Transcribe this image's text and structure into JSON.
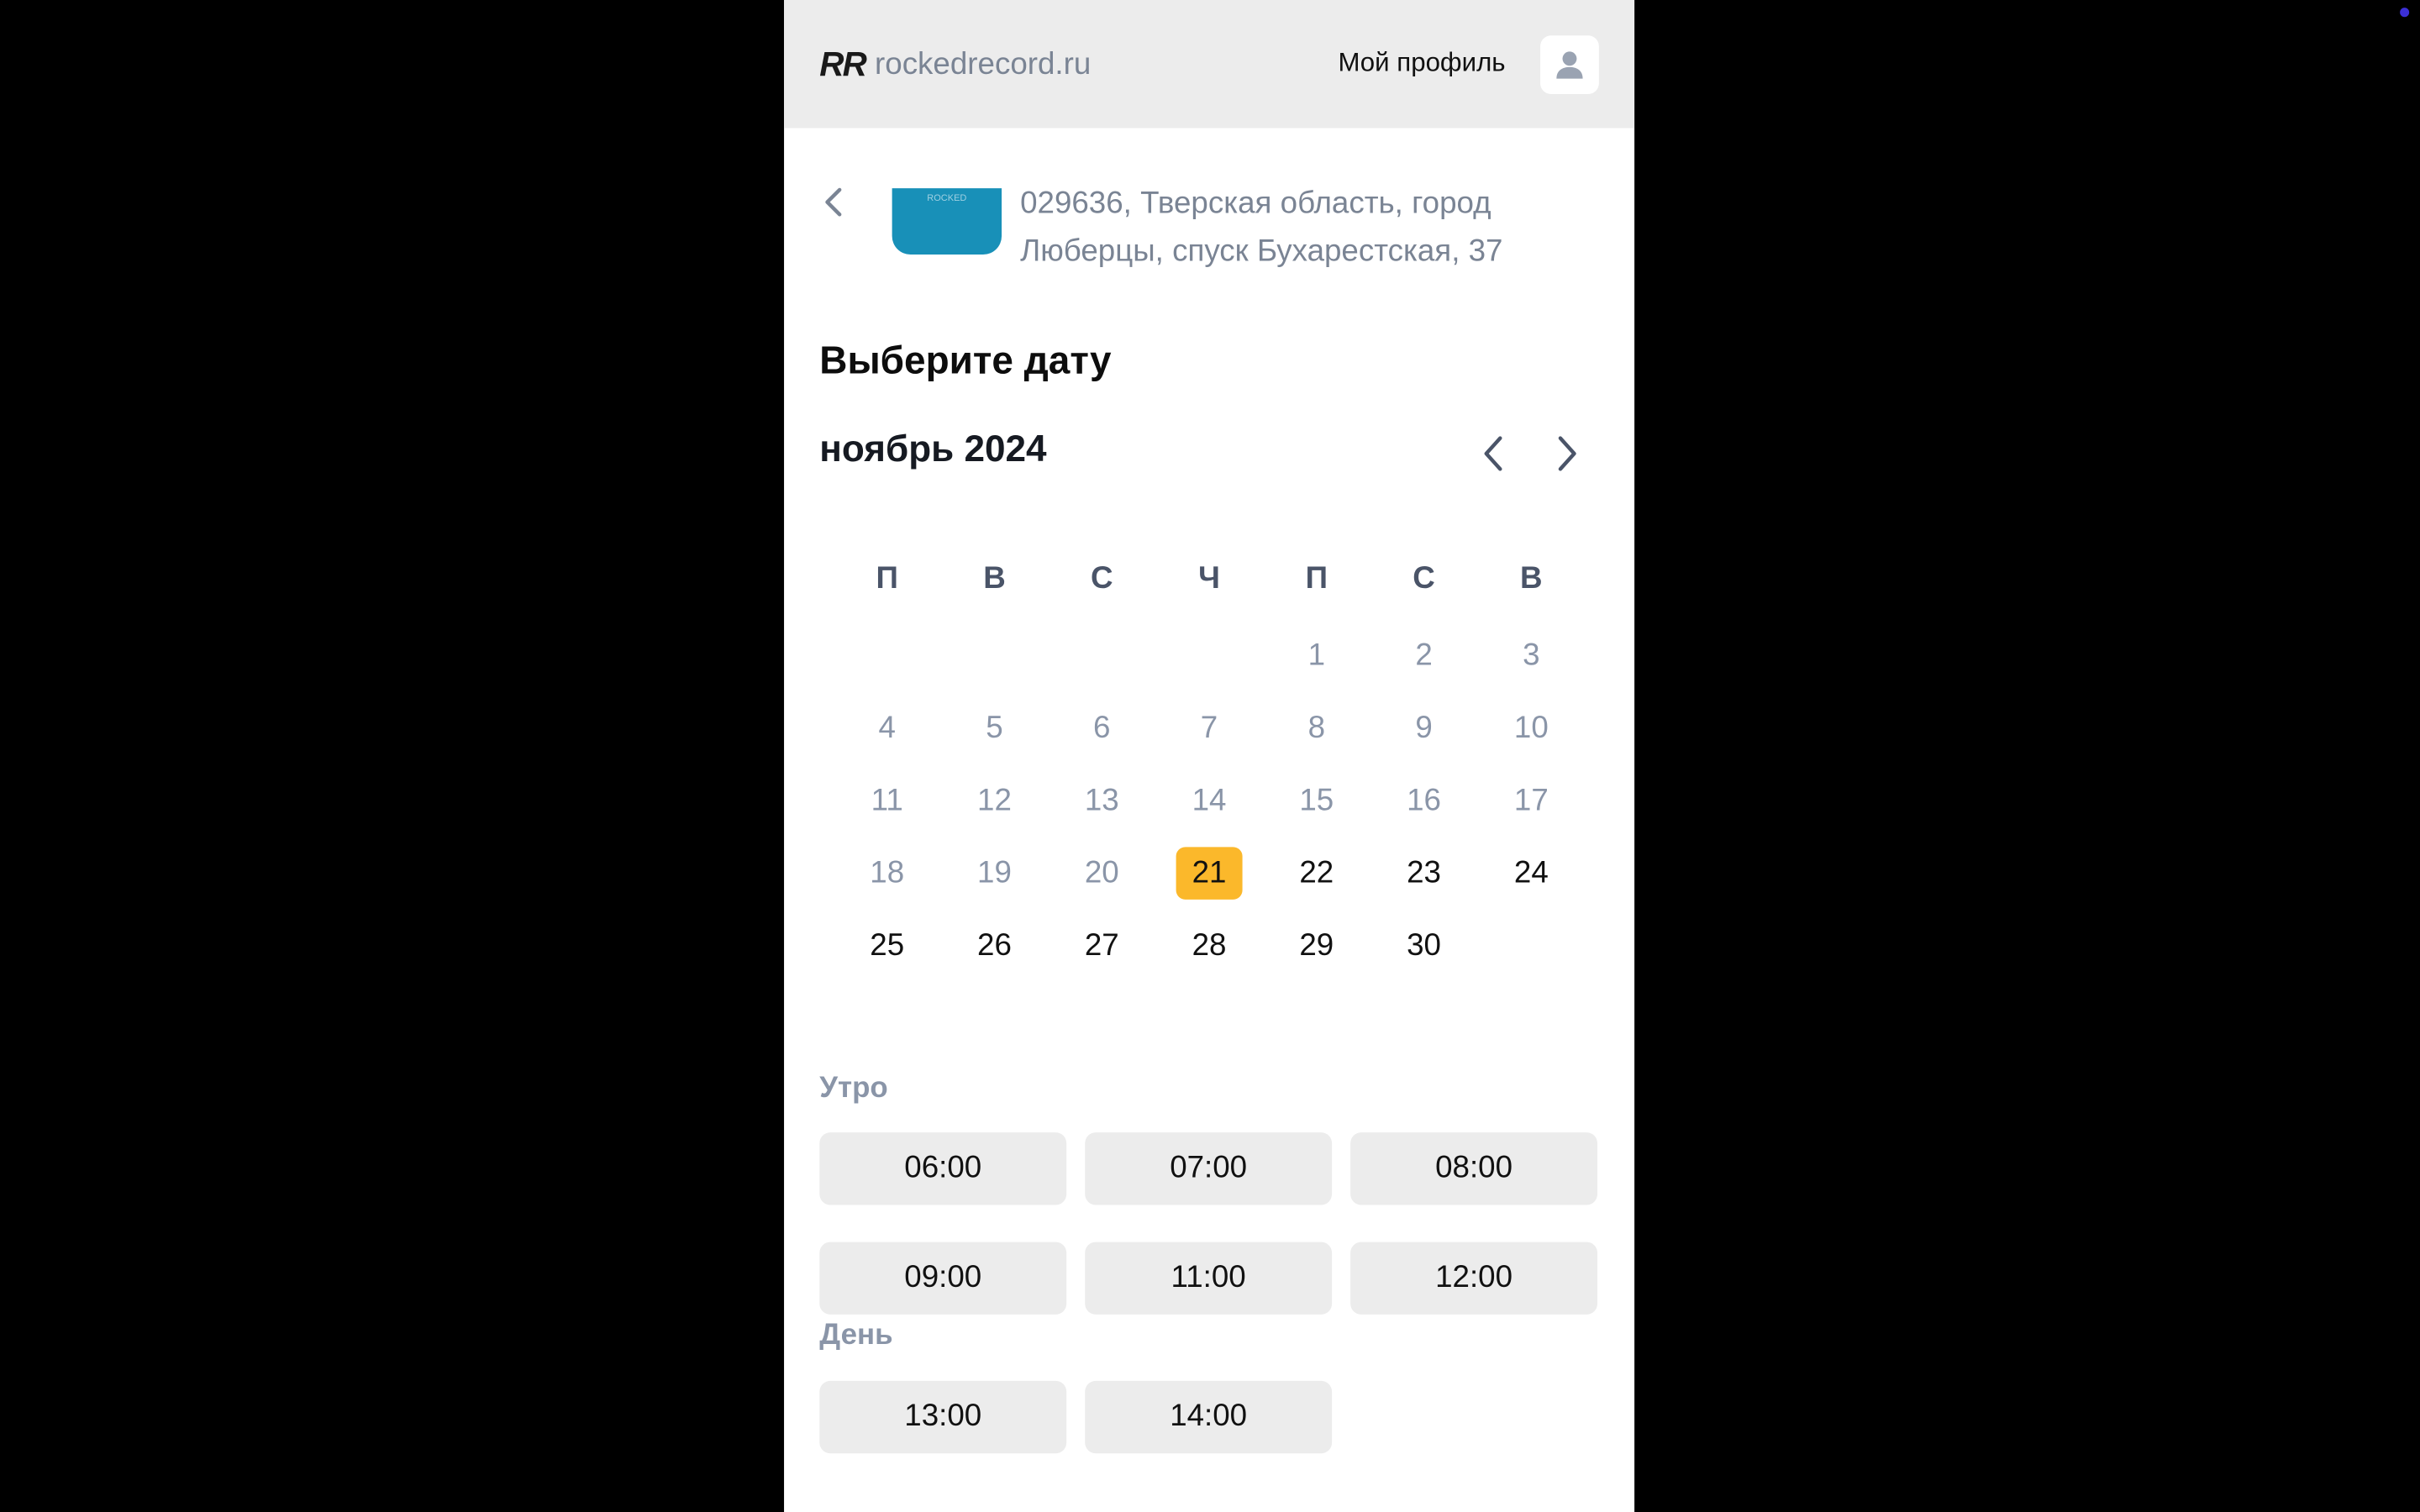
{
  "header": {
    "logo_mark": "RR",
    "logo_text": "rockedrecord.ru",
    "profile_label": "Мой профиль"
  },
  "location": {
    "address": "029636, Тверская область, город Люберцы, спуск Бухарестская, 37",
    "thumb_text": "ROCKED"
  },
  "calendar": {
    "title": "Выберите дату",
    "month": "ноябрь 2024",
    "weekdays": [
      "П",
      "В",
      "С",
      "Ч",
      "П",
      "С",
      "В"
    ],
    "weeks": [
      [
        {
          "d": ""
        },
        {
          "d": ""
        },
        {
          "d": ""
        },
        {
          "d": ""
        },
        {
          "d": "1",
          "s": "past"
        },
        {
          "d": "2",
          "s": "past"
        },
        {
          "d": "3",
          "s": "past"
        }
      ],
      [
        {
          "d": "4",
          "s": "past"
        },
        {
          "d": "5",
          "s": "past"
        },
        {
          "d": "6",
          "s": "past"
        },
        {
          "d": "7",
          "s": "past"
        },
        {
          "d": "8",
          "s": "past"
        },
        {
          "d": "9",
          "s": "past"
        },
        {
          "d": "10",
          "s": "past"
        }
      ],
      [
        {
          "d": "11",
          "s": "past"
        },
        {
          "d": "12",
          "s": "past"
        },
        {
          "d": "13",
          "s": "past"
        },
        {
          "d": "14",
          "s": "past"
        },
        {
          "d": "15",
          "s": "past"
        },
        {
          "d": "16",
          "s": "past"
        },
        {
          "d": "17",
          "s": "past"
        }
      ],
      [
        {
          "d": "18",
          "s": "past"
        },
        {
          "d": "19",
          "s": "past"
        },
        {
          "d": "20",
          "s": "past"
        },
        {
          "d": "21",
          "s": "selected"
        },
        {
          "d": "22",
          "s": "avail"
        },
        {
          "d": "23",
          "s": "avail"
        },
        {
          "d": "24",
          "s": "avail"
        }
      ],
      [
        {
          "d": "25",
          "s": "avail"
        },
        {
          "d": "26",
          "s": "avail"
        },
        {
          "d": "27",
          "s": "avail"
        },
        {
          "d": "28",
          "s": "avail"
        },
        {
          "d": "29",
          "s": "avail"
        },
        {
          "d": "30",
          "s": "avail"
        },
        {
          "d": ""
        }
      ]
    ],
    "selected_color": "#fbb82b"
  },
  "slots": {
    "morning_label": "Утро",
    "morning": [
      "06:00",
      "07:00",
      "08:00",
      "09:00",
      "11:00",
      "12:00"
    ],
    "day_label": "День",
    "day": [
      "13:00",
      "14:00"
    ]
  }
}
